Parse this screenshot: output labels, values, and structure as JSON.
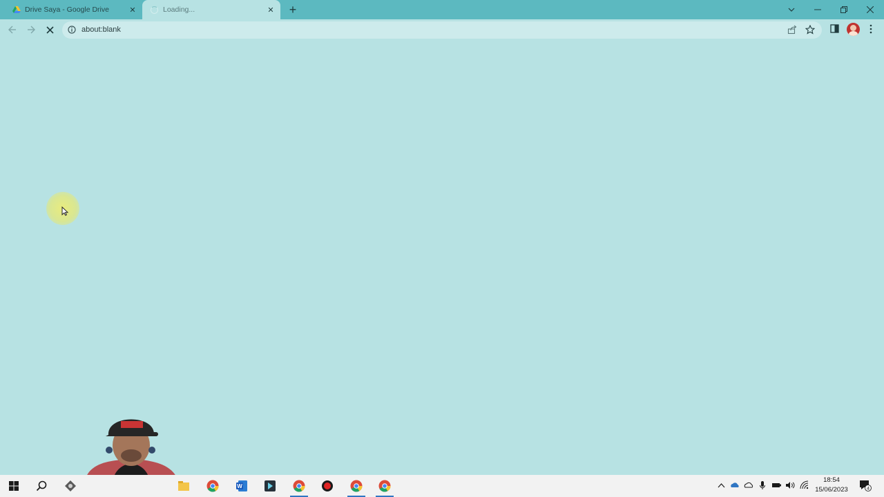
{
  "browser": {
    "tabs": [
      {
        "title": "Drive Saya - Google Drive",
        "close": "✕",
        "icon": "google-drive-icon"
      },
      {
        "title": "Loading...",
        "close": "✕",
        "icon": "loading-spinner-icon"
      }
    ],
    "new_tab_label": "+",
    "address_bar": {
      "url": "about:blank"
    },
    "accent_color": "#5cb9c0",
    "page_background": "#b7e2e3"
  },
  "taskbar": {
    "apps": [
      "start-icon",
      "search-icon",
      "app-icon",
      "file-explorer-icon",
      "chrome-icon",
      "word-icon",
      "app-icon",
      "chrome-icon",
      "record-icon",
      "chrome-icon",
      "chrome-icon"
    ],
    "clock": {
      "time": "18:54",
      "date": "15/06/2023"
    },
    "notification_count": "4"
  }
}
